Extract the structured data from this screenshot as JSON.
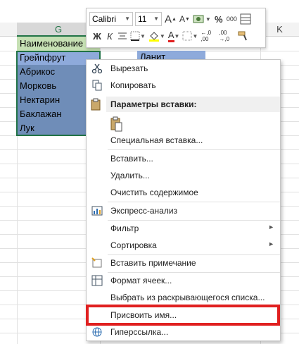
{
  "sheet": {
    "col_g": "G",
    "col_k": "K",
    "cells": [
      "Наименование",
      "Грейпфрут",
      "Абрикос",
      "Морковь",
      "Нектарин",
      "Баклажан",
      "Лук"
    ],
    "side_cell": "Ланит"
  },
  "mini_toolbar": {
    "font_name": "Calibri",
    "font_size": "11",
    "grow": "A",
    "shrink": "A",
    "percent": "%",
    "thousands": "000",
    "bold": "Ж",
    "italic": "К",
    "font_color_letter": "A",
    "dec_inc": "←,0 ,00",
    "dec_dec": ",00 →,0"
  },
  "menu": {
    "cut": "Вырезать",
    "copy": "Копировать",
    "paste_options": "Параметры вставки:",
    "paste_special": "Специальная вставка...",
    "insert": "Вставить...",
    "delete": "Удалить...",
    "clear": "Очистить содержимое",
    "quick_analysis": "Экспресс-анализ",
    "filter": "Фильтр",
    "sort": "Сортировка",
    "insert_comment": "Вставить примечание",
    "format_cells": "Формат ячеек...",
    "pick_list": "Выбрать из раскрывающегося списка...",
    "define_name": "Присвоить имя...",
    "hyperlink": "Гиперссылка..."
  },
  "colors": {
    "excel_green": "#217346",
    "highlight": "#e02020",
    "selection": "#6f8db8"
  }
}
